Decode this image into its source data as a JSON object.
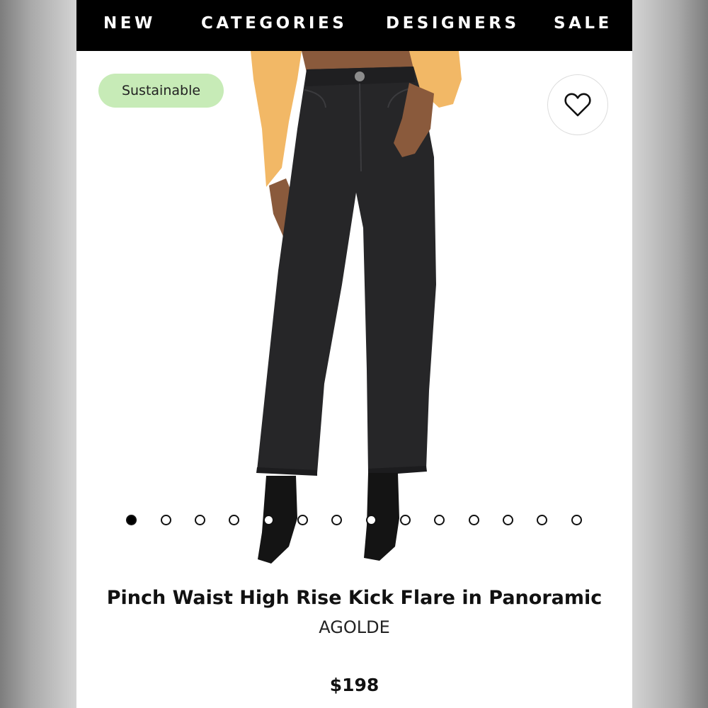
{
  "nav": {
    "items": [
      "NEW",
      "CATEGORIES",
      "DESIGNERS",
      "SALE"
    ]
  },
  "badge": {
    "label": "Sustainable",
    "color": "#c7ebb7"
  },
  "favorite": {
    "icon": "heart-outline-icon"
  },
  "carousel": {
    "total": 14,
    "active_index": 0
  },
  "product": {
    "title": "Pinch Waist High Rise Kick Flare in Panoramic",
    "brand": "AGOLDE",
    "price": "$198"
  },
  "colors": {
    "nav_background": "#000000",
    "nav_text": "#ffffff",
    "sweater": "#f2b866",
    "jeans": "#262628",
    "boots": "#141414"
  }
}
